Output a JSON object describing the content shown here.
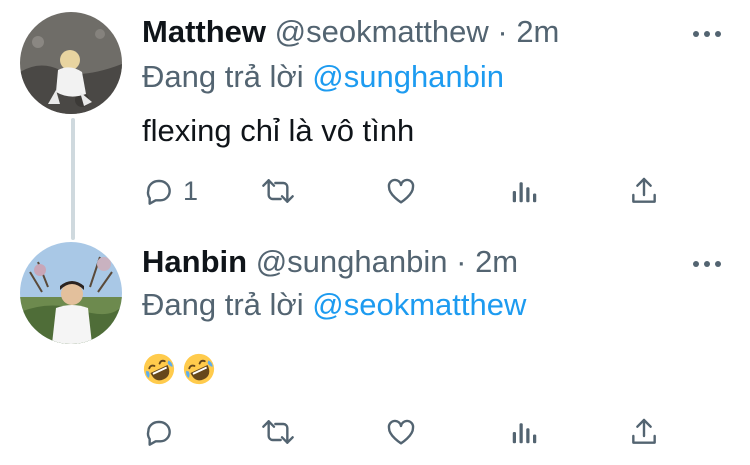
{
  "tweets": [
    {
      "name": "Matthew",
      "handle": "@seokmatthew",
      "dot": "·",
      "time": "2m",
      "reply_prefix": "Đang trả lời",
      "reply_to": "@sunghanbin",
      "text": "flexing chỉ là vô tình",
      "reply_count": "1"
    },
    {
      "name": "Hanbin",
      "handle": "@sunghanbin",
      "dot": "·",
      "time": "2m",
      "reply_prefix": "Đang trả lời",
      "reply_to": "@seokmatthew",
      "emojis": [
        "rolling-on-floor-laughing",
        "rolling-on-floor-laughing"
      ]
    }
  ],
  "icons": [
    "reply-icon",
    "retweet-icon",
    "like-icon",
    "analytics-icon",
    "share-icon",
    "more-icon"
  ],
  "colors": {
    "text": "#0f1419",
    "secondary": "#536471",
    "mention": "#1d9bf0"
  }
}
